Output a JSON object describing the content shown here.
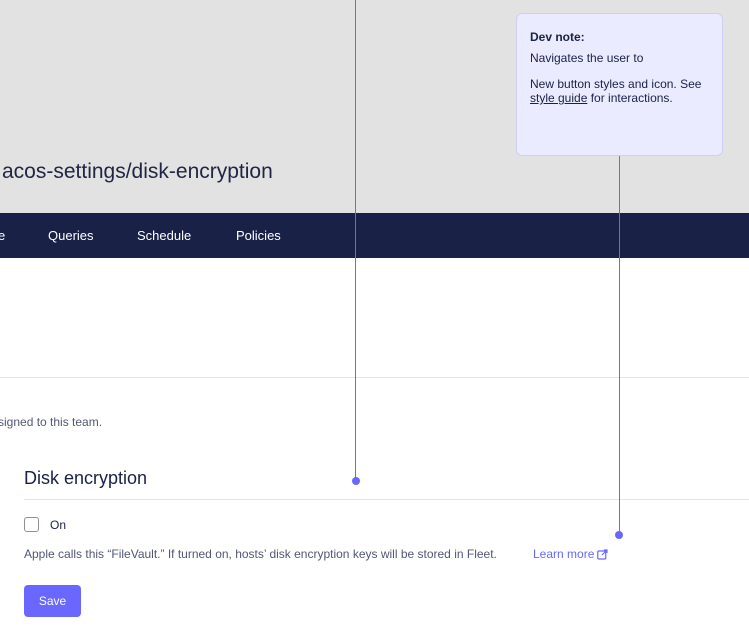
{
  "header": {
    "url_path": "acos-settings/disk-encryption"
  },
  "nav": {
    "items": [
      {
        "label": "e"
      },
      {
        "label": "Queries"
      },
      {
        "label": "Schedule"
      },
      {
        "label": "Policies"
      }
    ]
  },
  "content": {
    "assigned_text": "signed to this team.",
    "section_title": "Disk encryption",
    "checkbox_label": "On",
    "checkbox_checked": false,
    "help_text": "Apple calls this “FileVault.” If turned on, hosts’ disk encryption keys will be stored in Fleet.",
    "learn_more": "Learn more",
    "save_label": "Save"
  },
  "dev_note": {
    "title": "Dev note:",
    "line1": "Navigates the user to",
    "line2_prefix": "New button styles and icon. See",
    "line2_link": "style guide",
    "line2_suffix": "for interactions."
  },
  "colors": {
    "accent": "#6a67fe",
    "navbar": "#192147",
    "note_bg": "#ebebff"
  }
}
